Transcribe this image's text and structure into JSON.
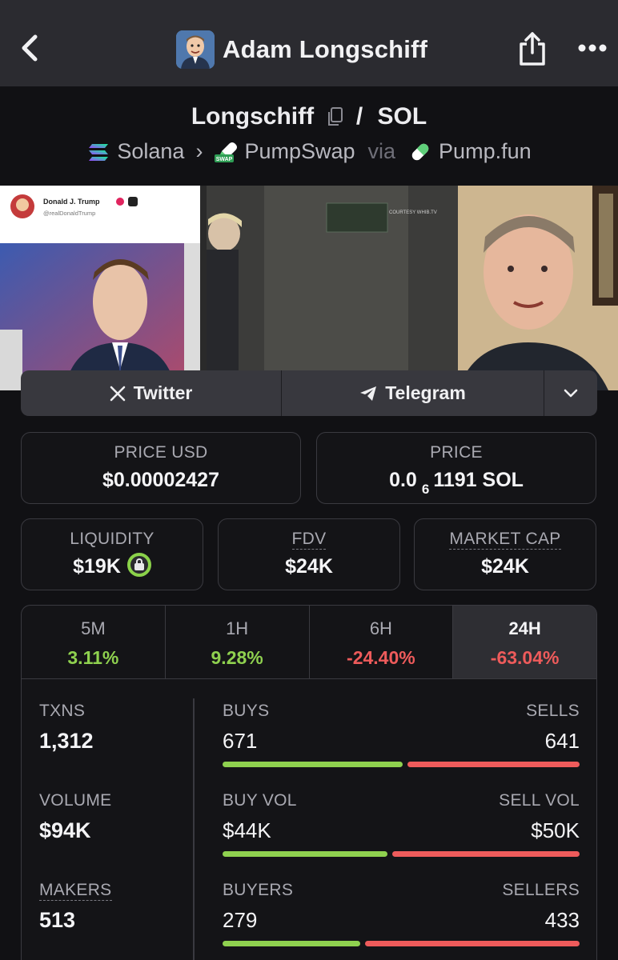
{
  "nav": {
    "title": "Adam Longschiff"
  },
  "pair": {
    "base": "Longschiff",
    "slash": "/",
    "quote": "SOL",
    "chain": "Solana",
    "dex": "PumpSwap",
    "via": "via",
    "launchpad": "Pump.fun"
  },
  "banner": {
    "tweet_name": "Donald J. Trump",
    "tweet_handle": "@realDonaldTrump",
    "watermark": "COURTESY WHIB.TV"
  },
  "socials": {
    "twitter": "Twitter",
    "telegram": "Telegram"
  },
  "price_usd": {
    "label": "PRICE USD",
    "value": "$0.00002427"
  },
  "price_native": {
    "label": "PRICE",
    "prefix": "0.0",
    "zeros": "6",
    "digits": "1191",
    "unit": "SOL"
  },
  "liquidity": {
    "label": "LIQUIDITY",
    "value": "$19K"
  },
  "fdv": {
    "label": "FDV",
    "value": "$24K"
  },
  "market_cap": {
    "label": "MARKET CAP",
    "value": "$24K"
  },
  "timeframes": [
    {
      "label": "5M",
      "change": "3.11%"
    },
    {
      "label": "1H",
      "change": "9.28%"
    },
    {
      "label": "6H",
      "change": "-24.40%"
    },
    {
      "label": "24H",
      "change": "-63.04%"
    }
  ],
  "stats": {
    "txns_label": "TXNS",
    "txns": "1,312",
    "volume_label": "VOLUME",
    "volume": "$94K",
    "makers_label": "MAKERS",
    "makers": "513",
    "buys_label": "BUYS",
    "buys": "671",
    "sells_label": "SELLS",
    "sells": "641",
    "buy_vol_label": "BUY VOL",
    "buy_vol": "$44K",
    "sell_vol_label": "SELL VOL",
    "sell_vol": "$50K",
    "buyers_label": "BUYERS",
    "buyers": "279",
    "sellers_label": "SELLERS",
    "sellers": "433",
    "buys_share": 0.511,
    "buy_vol_share": 0.468,
    "buyers_share": 0.392
  },
  "colors": {
    "positive": "#8fd14f",
    "negative": "#ee5b5b",
    "lock_ring": "#8bd24a"
  },
  "icons": [
    "back-chevron-icon",
    "share-icon",
    "more-icon",
    "copy-icon",
    "solana-icon",
    "pumpswap-icon",
    "pill-icon",
    "x-logo-icon",
    "telegram-icon",
    "chevron-down-icon",
    "lock-icon"
  ]
}
